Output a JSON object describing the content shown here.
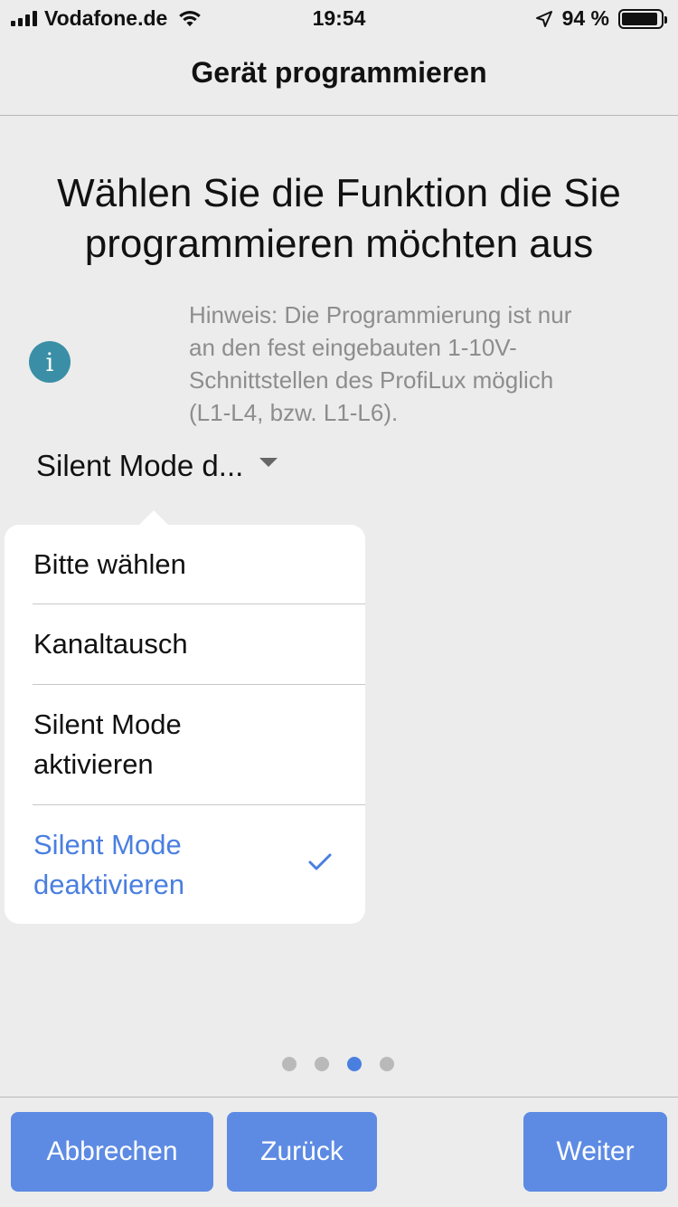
{
  "status_bar": {
    "carrier": "Vodafone.de",
    "time": "19:54",
    "battery": "94 %"
  },
  "nav": {
    "title": "Gerät programmieren"
  },
  "heading": "Wählen Sie die Funktion die Sie programmieren möchten aus",
  "hint": "Hinweis: Die Programmierung ist nur an den fest eingebauten 1-10V-Schnittstellen des ProfiLux möglich (L1-L4, bzw. L1-L6).",
  "info_icon_glyph": "i",
  "dropdown": {
    "selected_label": "Silent Mode d..."
  },
  "options": [
    {
      "label": "Bitte wählen"
    },
    {
      "label": "Kanaltausch"
    },
    {
      "label": "Silent Mode aktivieren"
    },
    {
      "label": "Silent Mode deaktivieren",
      "selected": true
    }
  ],
  "pagination": {
    "count": 4,
    "active_index": 2
  },
  "toolbar": {
    "cancel_label": "Abbrechen",
    "back_label": "Zurück",
    "next_label": "Weiter"
  },
  "colors": {
    "accent": "#4a7fe0",
    "button": "#5d8be3",
    "info": "#3a8fa6",
    "background": "#ececec"
  }
}
